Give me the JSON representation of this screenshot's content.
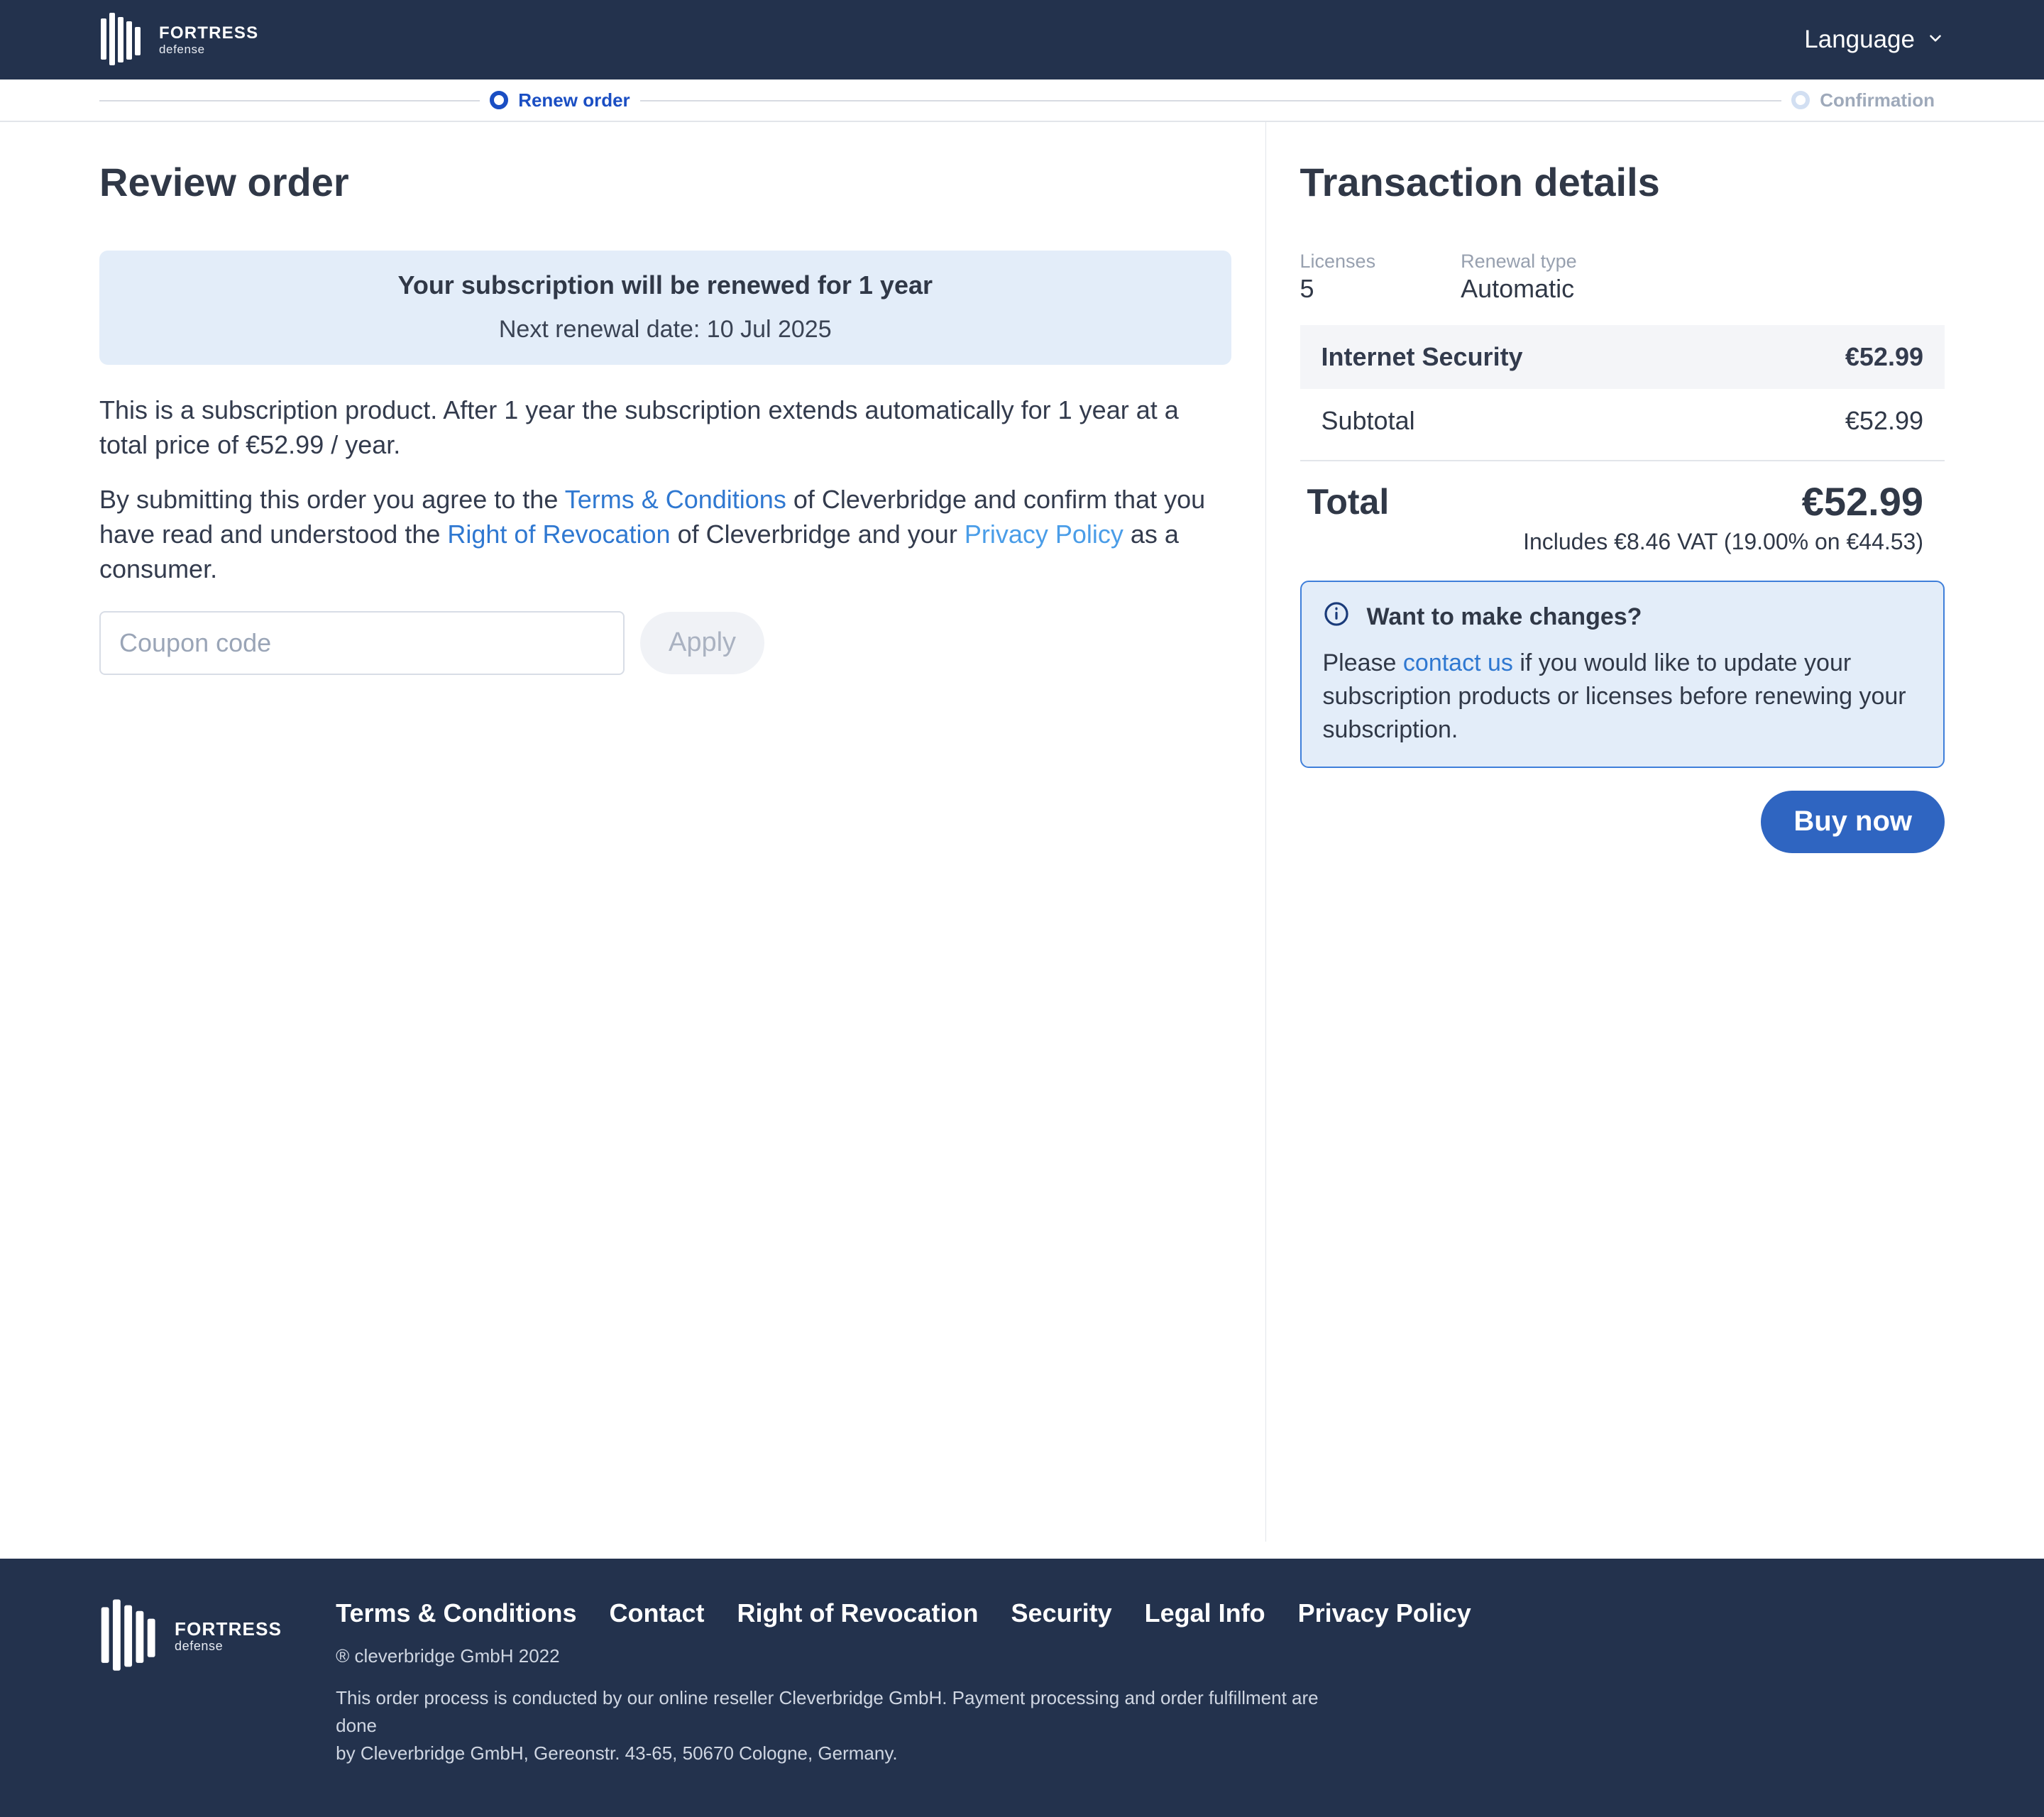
{
  "header": {
    "brand_name": "FORTRESS",
    "brand_sub": "defense",
    "language_label": "Language"
  },
  "progress": {
    "step_current": "Renew order",
    "step_next": "Confirmation"
  },
  "left": {
    "title": "Review order",
    "banner_line1": "Your subscription will be renewed for 1 year",
    "banner_line2": "Next renewal date: 10 Jul 2025",
    "paragraph1": "This is a subscription product. After 1 year the subscription extends automatically for 1 year at a total price of €52.99 / year.",
    "paragraph2_pre": "By submitting this order you agree to the ",
    "paragraph2_link1": "Terms & Conditions",
    "paragraph2_mid": " of Cleverbridge and confirm that you have read and understood the ",
    "paragraph2_link2": "Right of Revocation",
    "paragraph2_mid2": " of Cleverbridge and your ",
    "paragraph2_link3": "Privacy Policy",
    "paragraph2_post": " as a consumer.",
    "coupon_placeholder": "Coupon code",
    "apply_label": "Apply"
  },
  "right": {
    "title": "Transaction details",
    "licenses_label": "Licenses",
    "licenses_value": "5",
    "renewal_type_label": "Renewal type",
    "renewal_type_value": "Automatic",
    "product_name": "Internet Security",
    "product_price": "€52.99",
    "subtotal_label": "Subtotal",
    "subtotal_value": "€52.99",
    "total_label": "Total",
    "total_value": "€52.99",
    "tax_note": "Includes €8.46 VAT (19.00% on €44.53)",
    "changes_title": "Want to make changes?",
    "changes_pre": "Please ",
    "changes_link": "contact us",
    "changes_post": " if you would like to update your subscription products or licenses before renewing your subscription.",
    "buy_label": "Buy now"
  },
  "footer": {
    "brand_name": "FORTRESS",
    "brand_sub": "defense",
    "links": [
      "Terms & Conditions",
      "Contact",
      "Right of Revocation",
      "Security",
      "Legal Info",
      "Privacy Policy"
    ],
    "trademark": "® cleverbridge GmbH 2022",
    "note1": "This order process is conducted by our online reseller Cleverbridge GmbH. Payment processing and order fulfillment are done",
    "note2": "by Cleverbridge GmbH, Gereonstr. 43-65, 50670 Cologne, Germany."
  },
  "colors": {
    "navy": "#23324d",
    "link": "#2f78d1",
    "outline_blue": "#3f7fda",
    "btn_blue": "#2f65c1"
  }
}
